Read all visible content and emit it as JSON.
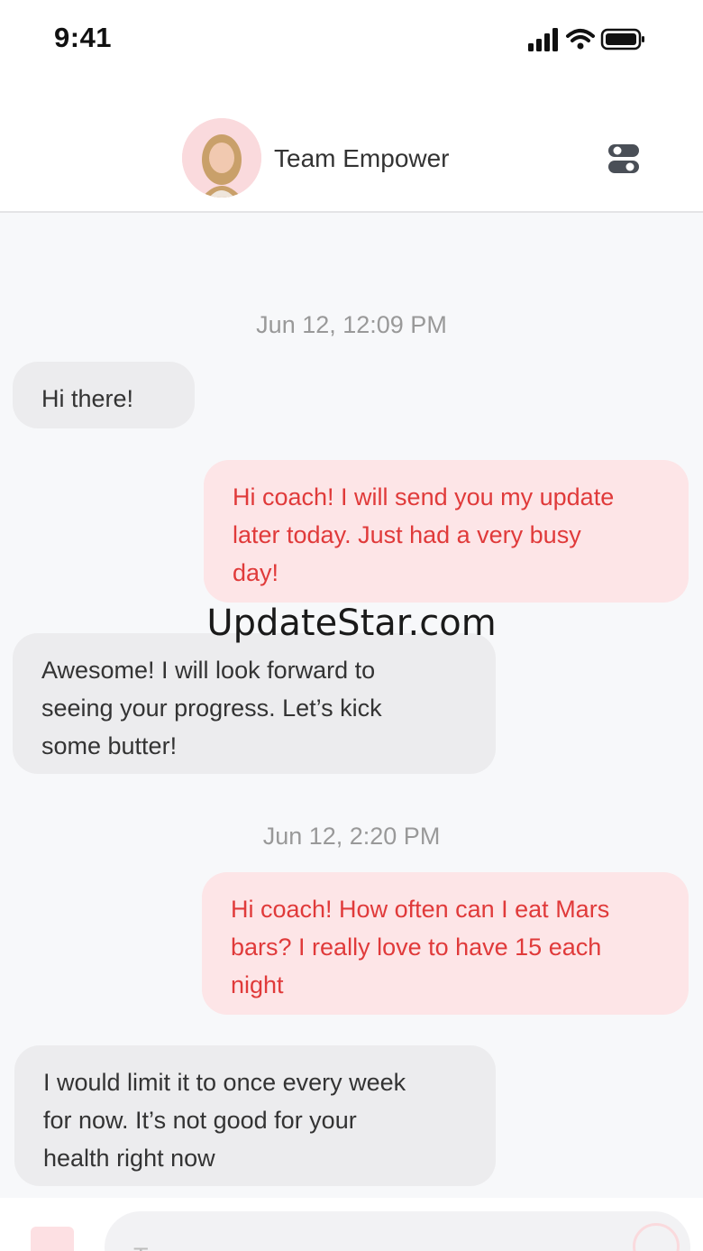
{
  "status_bar": {
    "time": "9:41"
  },
  "header": {
    "title": "Team Empower"
  },
  "messages": [
    {
      "type": "timestamp",
      "text": "Jun 12, 12:09 PM"
    },
    {
      "type": "incoming",
      "text": "Hi there!"
    },
    {
      "type": "outgoing",
      "text": "Hi coach! I will send you my update\nlater today. Just had a very busy\nday!"
    },
    {
      "type": "incoming",
      "text": "Awesome! I will look forward to\nseeing your progress. Let’s kick\nsome butter!"
    },
    {
      "type": "timestamp",
      "text": "Jun 12, 2:20 PM"
    },
    {
      "type": "outgoing",
      "text": "Hi coach! How often can I eat Mars\nbars? I really love to have 15 each\nnight"
    },
    {
      "type": "incoming",
      "text": "I would limit it to once every week\nfor now. It’s not good for your\nhealth right now"
    }
  ],
  "watermark": "UpdateStar.com",
  "composer": {
    "placeholder": "Type a message...",
    "value": ""
  },
  "colors": {
    "accent": "#e03a3a",
    "outgoing_bg": "#fde5e7",
    "incoming_bg": "#ececee"
  },
  "icons": [
    "cellular-signal-icon",
    "wifi-icon",
    "battery-icon",
    "settings-toggle-icon",
    "attach-image-icon",
    "send-icon"
  ]
}
